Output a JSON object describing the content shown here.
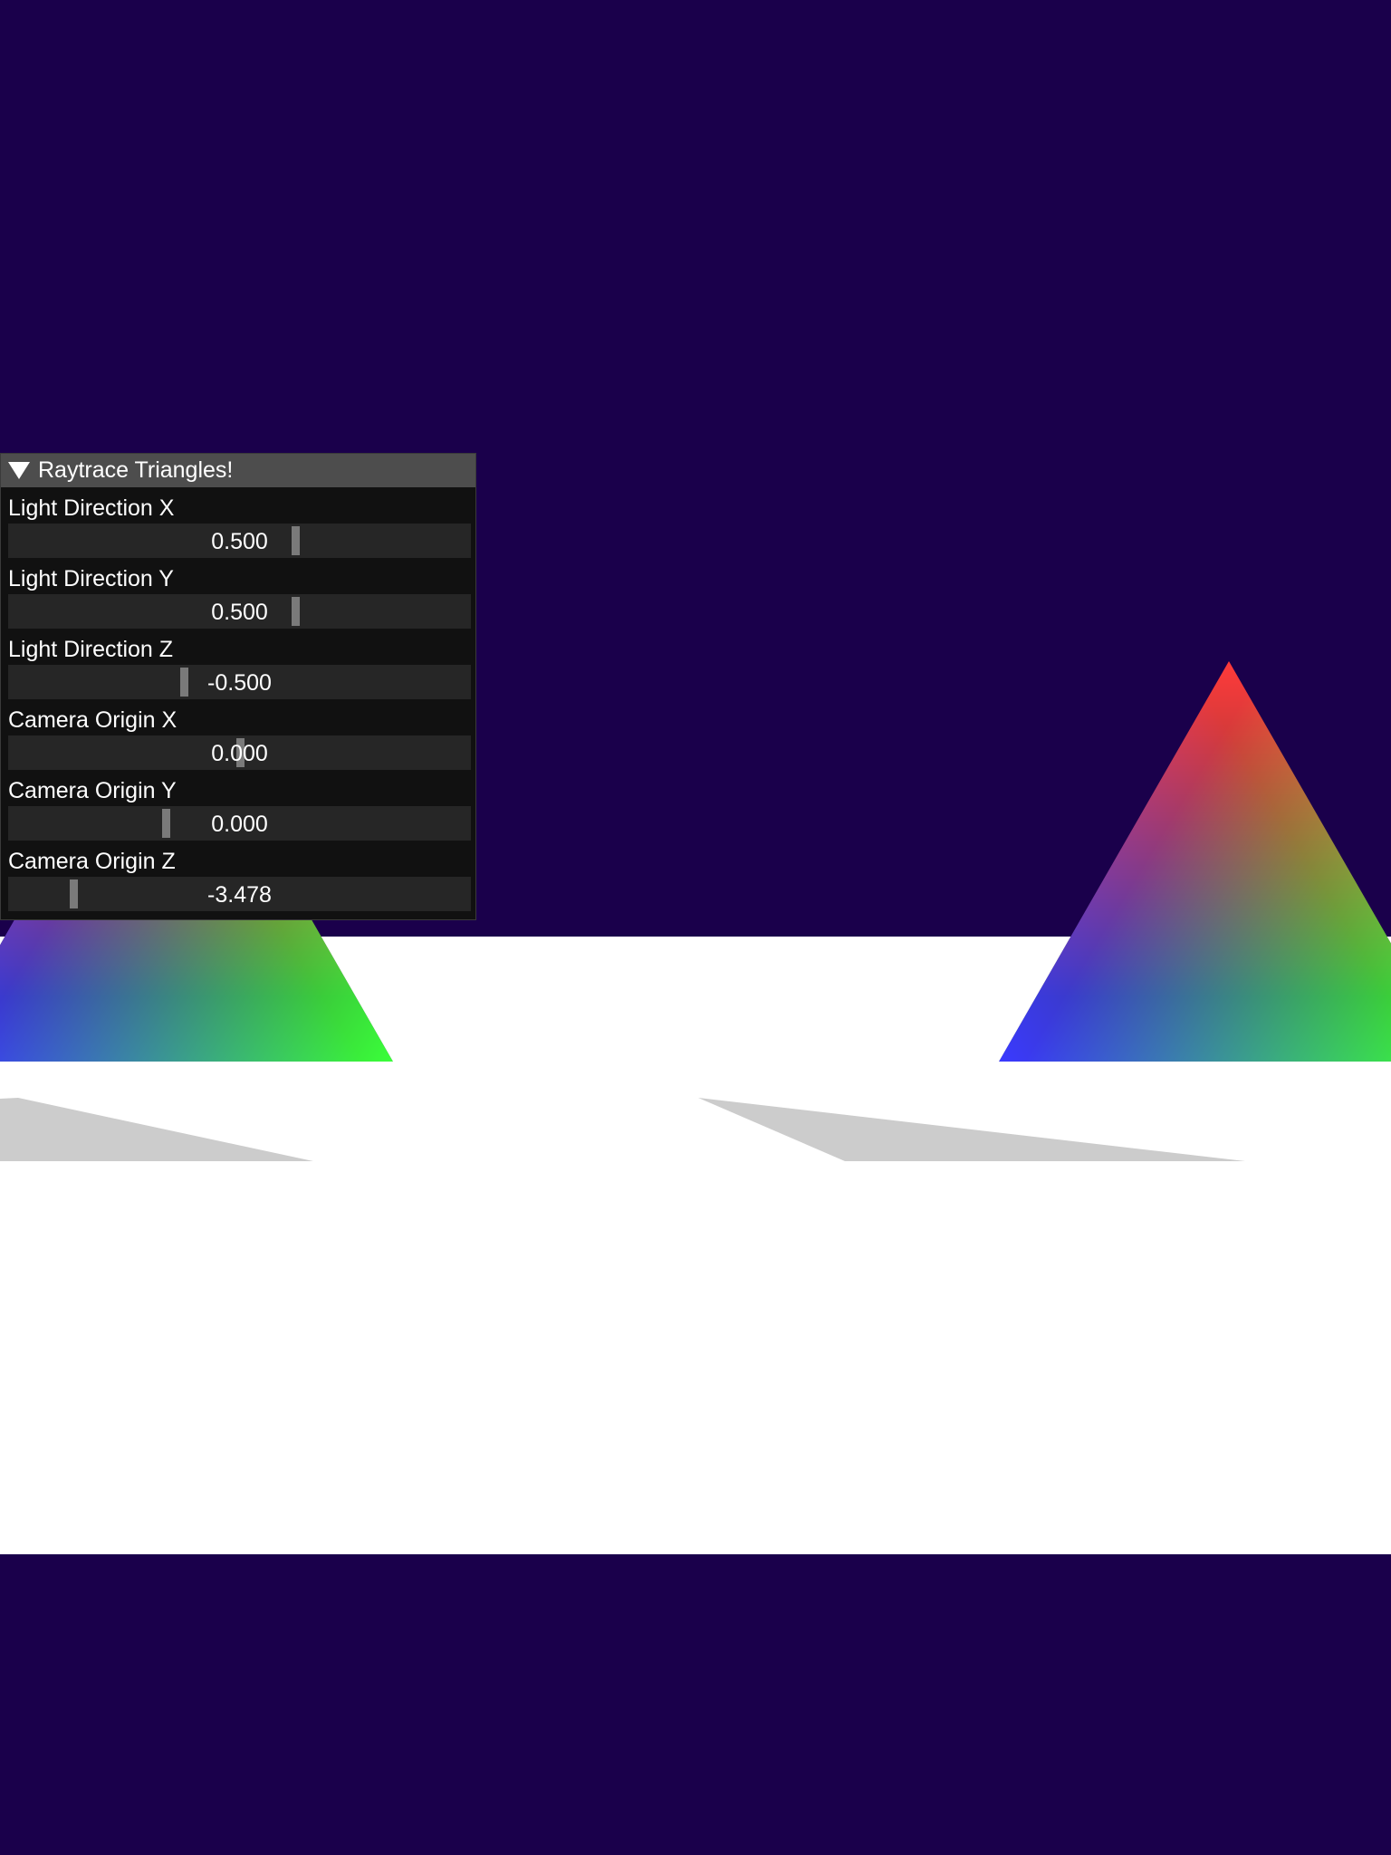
{
  "window": {
    "title": "Raytrace Triangles!",
    "collapse_icon": "collapse-triangle-icon"
  },
  "colors": {
    "background": "#1a004b",
    "panel_bg": "#111111",
    "header_bg": "#4d4d4d",
    "slider_bg": "#262626",
    "grab": "#7a7a7a",
    "floor": "#ffffff",
    "shadow": "#cccccc"
  },
  "controls": [
    {
      "label": "Light Direction X",
      "value_text": "0.500",
      "fraction": 0.62
    },
    {
      "label": "Light Direction Y",
      "value_text": "0.500",
      "fraction": 0.62
    },
    {
      "label": "Light Direction Z",
      "value_text": "-0.500",
      "fraction": 0.38
    },
    {
      "label": "Camera Origin X",
      "value_text": "0.000",
      "fraction": 0.5
    },
    {
      "label": "Camera Origin Y",
      "value_text": "0.000",
      "fraction": 0.34
    },
    {
      "label": "Camera Origin Z",
      "value_text": "-3.478",
      "fraction": 0.14
    }
  ]
}
